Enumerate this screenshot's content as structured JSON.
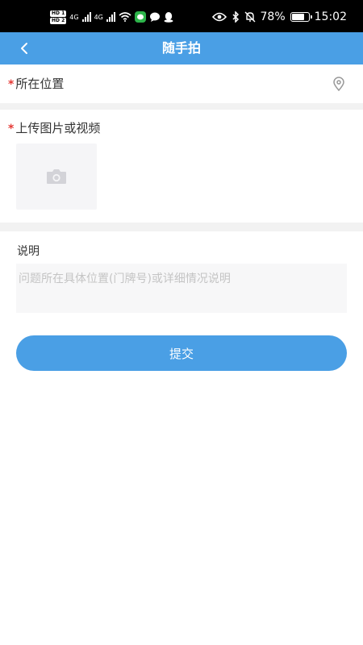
{
  "status_bar": {
    "hd1": "HD 1",
    "hd2": "HD 2",
    "net1": "4G",
    "net2": "4G",
    "battery": "78%",
    "battery_level": 0.78,
    "time": "15:02"
  },
  "nav": {
    "title": "随手拍",
    "back_icon": "chevron-left-icon",
    "bg_color": "#4a9fe5"
  },
  "form": {
    "required_mark": "*",
    "location_label": "所在位置",
    "location_icon": "map-pin-icon",
    "upload_label": "上传图片或视频",
    "upload_icon": "camera-icon",
    "description_label": "说明",
    "description_placeholder": "问题所在具体位置(门牌号)或详细情况说明",
    "description_value": ""
  },
  "actions": {
    "submit_label": "提交"
  }
}
